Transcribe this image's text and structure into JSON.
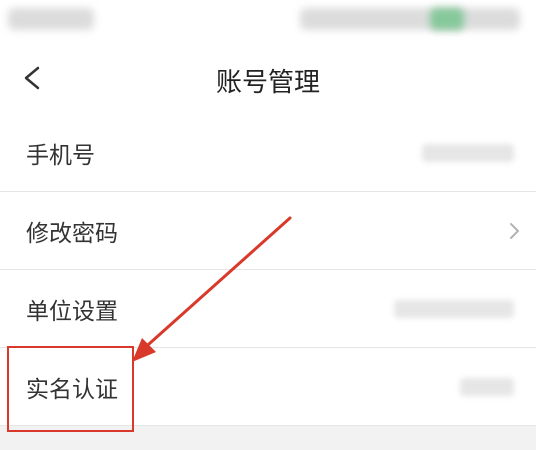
{
  "header": {
    "title": "账号管理",
    "back_icon": "chevron-left-icon"
  },
  "settings": [
    {
      "label": "手机号",
      "has_value": true,
      "has_chevron": false
    },
    {
      "label": "修改密码",
      "has_value": false,
      "has_chevron": true
    },
    {
      "label": "单位设置",
      "has_value": true,
      "has_chevron": false
    },
    {
      "label": "实名认证",
      "has_value": true,
      "has_chevron": false
    }
  ],
  "annotation": {
    "color": "#d8392b",
    "target": "实名认证"
  }
}
